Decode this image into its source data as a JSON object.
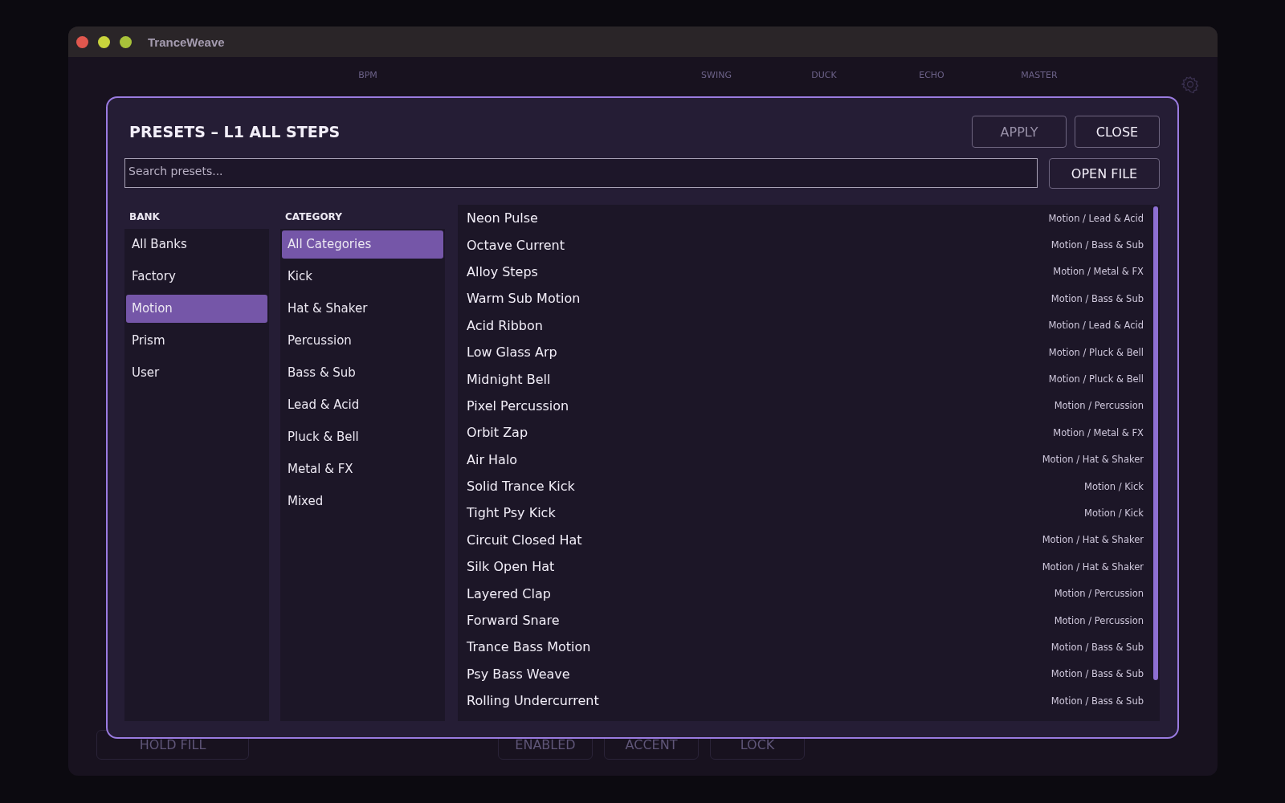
{
  "window": {
    "title": "TranceWeave"
  },
  "background": {
    "header_labels": [
      "BPM",
      "SWING",
      "DUCK",
      "ECHO",
      "MASTER"
    ],
    "footer_buttons": [
      {
        "label": "HOLD FILL"
      },
      {
        "label": "ENABLED"
      },
      {
        "label": "ACCENT"
      },
      {
        "label": "LOCK"
      }
    ]
  },
  "dialog": {
    "title": "PRESETS – L1 ALL STEPS",
    "buttons": [
      {
        "label": "APPLY",
        "disabled": true
      },
      {
        "label": "CLOSE",
        "disabled": false
      }
    ],
    "search": {
      "placeholder": "Search presets..."
    },
    "open_file": "OPEN FILE",
    "bank": {
      "heading": "BANK",
      "items": [
        {
          "label": "All Banks",
          "selected": false
        },
        {
          "label": "Factory",
          "selected": false
        },
        {
          "label": "Motion",
          "selected": true
        },
        {
          "label": "Prism",
          "selected": false
        },
        {
          "label": "User",
          "selected": false
        }
      ]
    },
    "category": {
      "heading": "CATEGORY",
      "items": [
        {
          "label": "All Categories",
          "selected": true
        },
        {
          "label": "Kick",
          "selected": false
        },
        {
          "label": "Hat & Shaker",
          "selected": false
        },
        {
          "label": "Percussion",
          "selected": false
        },
        {
          "label": "Bass & Sub",
          "selected": false
        },
        {
          "label": "Lead & Acid",
          "selected": false
        },
        {
          "label": "Pluck & Bell",
          "selected": false
        },
        {
          "label": "Metal & FX",
          "selected": false
        },
        {
          "label": "Mixed",
          "selected": false
        }
      ]
    },
    "presets": [
      {
        "name": "Neon Pulse",
        "path": "Motion / Lead & Acid"
      },
      {
        "name": "Octave Current",
        "path": "Motion / Bass & Sub"
      },
      {
        "name": "Alloy Steps",
        "path": "Motion / Metal & FX"
      },
      {
        "name": "Warm Sub Motion",
        "path": "Motion / Bass & Sub"
      },
      {
        "name": "Acid Ribbon",
        "path": "Motion / Lead & Acid"
      },
      {
        "name": "Low Glass Arp",
        "path": "Motion / Pluck & Bell"
      },
      {
        "name": "Midnight Bell",
        "path": "Motion / Pluck & Bell"
      },
      {
        "name": "Pixel Percussion",
        "path": "Motion / Percussion"
      },
      {
        "name": "Orbit Zap",
        "path": "Motion / Metal & FX"
      },
      {
        "name": "Air Halo",
        "path": "Motion / Hat & Shaker"
      },
      {
        "name": "Solid Trance Kick",
        "path": "Motion / Kick"
      },
      {
        "name": "Tight Psy Kick",
        "path": "Motion / Kick"
      },
      {
        "name": "Circuit Closed Hat",
        "path": "Motion / Hat & Shaker"
      },
      {
        "name": "Silk Open Hat",
        "path": "Motion / Hat & Shaker"
      },
      {
        "name": "Layered Clap",
        "path": "Motion / Percussion"
      },
      {
        "name": "Forward Snare",
        "path": "Motion / Percussion"
      },
      {
        "name": "Trance Bass Motion",
        "path": "Motion / Bass & Sub"
      },
      {
        "name": "Psy Bass Weave",
        "path": "Motion / Bass & Sub"
      },
      {
        "name": "Rolling Undercurrent",
        "path": "Motion / Bass & Sub"
      }
    ]
  }
}
